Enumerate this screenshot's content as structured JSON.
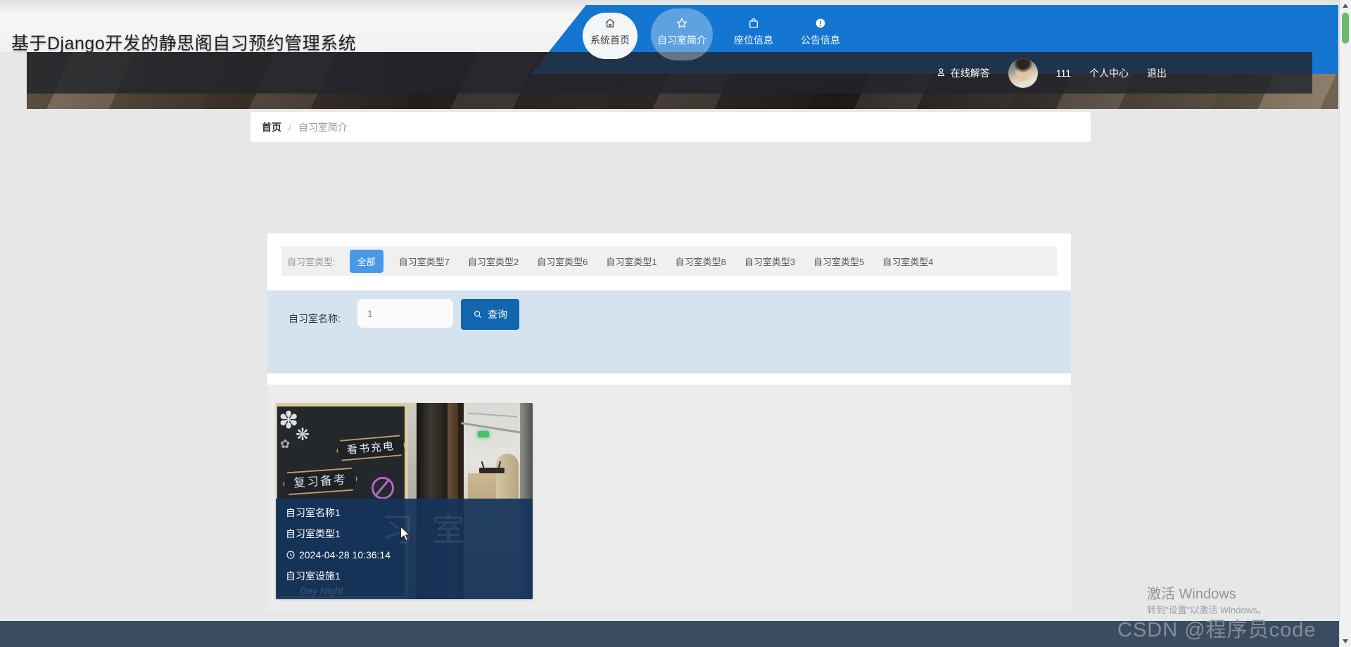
{
  "header": {
    "title": "基于Django开发的静思阁自习预约管理系统"
  },
  "nav": {
    "items": [
      {
        "label": "系统首页",
        "icon": "home-icon",
        "active": false
      },
      {
        "label": "自习室简介",
        "icon": "star-icon",
        "active": true
      },
      {
        "label": "座位信息",
        "icon": "bag-icon",
        "active": false
      },
      {
        "label": "公告信息",
        "icon": "info-icon",
        "active": false
      }
    ]
  },
  "userbar": {
    "qa_label": "在线解答",
    "username": "111",
    "profile_label": "个人中心",
    "logout_label": "退出"
  },
  "breadcrumb": {
    "home": "首页",
    "separator": "/",
    "current": "自习室简介"
  },
  "filter": {
    "label": "自习室类型:",
    "selected": "全部",
    "options": [
      "全部",
      "自习室类型7",
      "自习室类型2",
      "自习室类型6",
      "自习室类型1",
      "自习室类型8",
      "自习室类型3",
      "自习室类型5",
      "自习室类型4"
    ]
  },
  "search": {
    "label": "自习室名称:",
    "value": "1",
    "button_label": "查询"
  },
  "room_card": {
    "name": "自习室名称1",
    "type": "自习室类型1",
    "time": "2024-04-28 10:36:14",
    "facility": "自习室设施1",
    "photo": {
      "banner1": "看书充电",
      "banner2": "复习备考",
      "ghost_text": "习室",
      "ghost_small": "Day Night"
    }
  },
  "watermark": {
    "activate_title": "激活 Windows",
    "activate_sub": "转到\"设置\"以激活 Windows。",
    "csdn": "CSDN @程序员code"
  },
  "colors": {
    "nav_blue": "#1476d1",
    "tag_blue": "#4898e8",
    "button_blue": "#1265af",
    "search_section_bg": "#d5e3f0",
    "card_overlay": "#14345c",
    "footer": "#3a4c61"
  }
}
